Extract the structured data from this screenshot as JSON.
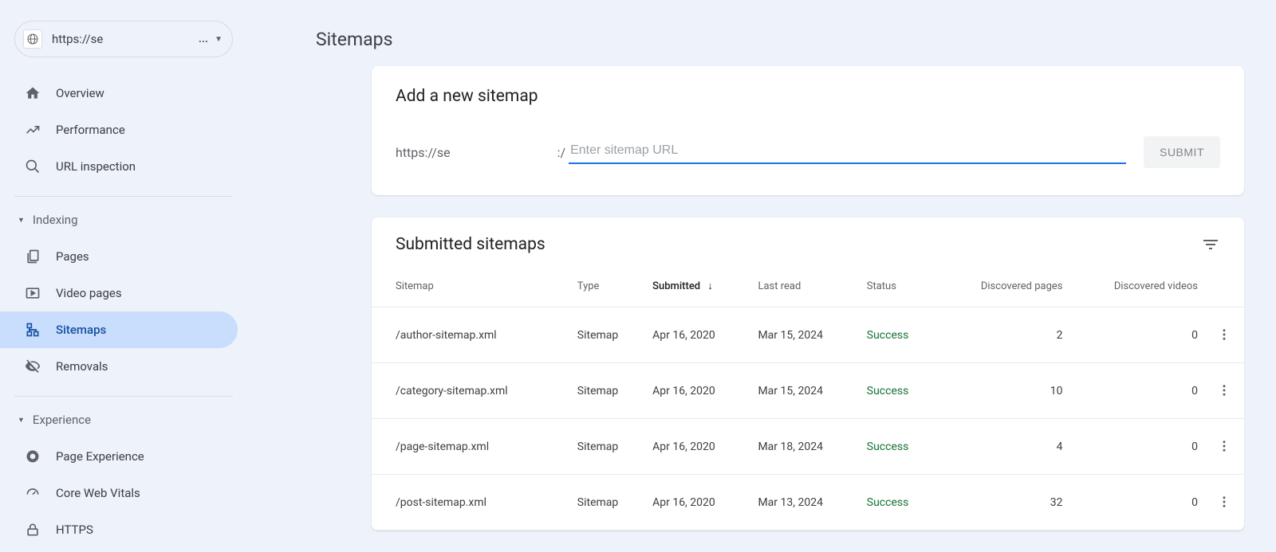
{
  "property_selector": {
    "url": "https://se",
    "ellipsis": "..."
  },
  "sidebar": {
    "items_top": [
      {
        "id": "overview",
        "label": "Overview"
      },
      {
        "id": "performance",
        "label": "Performance"
      },
      {
        "id": "url-inspection",
        "label": "URL inspection"
      }
    ],
    "group_indexing": {
      "label": "Indexing",
      "items": [
        {
          "id": "pages",
          "label": "Pages"
        },
        {
          "id": "video-pages",
          "label": "Video pages"
        },
        {
          "id": "sitemaps",
          "label": "Sitemaps",
          "active": true
        },
        {
          "id": "removals",
          "label": "Removals"
        }
      ]
    },
    "group_experience": {
      "label": "Experience",
      "items": [
        {
          "id": "page-experience",
          "label": "Page Experience"
        },
        {
          "id": "core-web-vitals",
          "label": "Core Web Vitals"
        },
        {
          "id": "https",
          "label": "HTTPS"
        }
      ]
    }
  },
  "page": {
    "title": "Sitemaps"
  },
  "add_card": {
    "title": "Add a new sitemap",
    "url_prefix": "https://se",
    "url_slash": ":/",
    "placeholder": "Enter sitemap URL",
    "submit_label": "SUBMIT"
  },
  "table_card": {
    "title": "Submitted sitemaps",
    "columns": {
      "sitemap": "Sitemap",
      "type": "Type",
      "submitted": "Submitted",
      "last_read": "Last read",
      "status": "Status",
      "discovered_pages": "Discovered pages",
      "discovered_videos": "Discovered videos"
    },
    "rows": [
      {
        "sitemap": "/author-sitemap.xml",
        "type": "Sitemap",
        "submitted": "Apr 16, 2020",
        "last_read": "Mar 15, 2024",
        "status": "Success",
        "discovered_pages": "2",
        "discovered_videos": "0"
      },
      {
        "sitemap": "/category-sitemap.xml",
        "type": "Sitemap",
        "submitted": "Apr 16, 2020",
        "last_read": "Mar 15, 2024",
        "status": "Success",
        "discovered_pages": "10",
        "discovered_videos": "0"
      },
      {
        "sitemap": "/page-sitemap.xml",
        "type": "Sitemap",
        "submitted": "Apr 16, 2020",
        "last_read": "Mar 18, 2024",
        "status": "Success",
        "discovered_pages": "4",
        "discovered_videos": "0"
      },
      {
        "sitemap": "/post-sitemap.xml",
        "type": "Sitemap",
        "submitted": "Apr 16, 2020",
        "last_read": "Mar 13, 2024",
        "status": "Success",
        "discovered_pages": "32",
        "discovered_videos": "0"
      }
    ]
  }
}
